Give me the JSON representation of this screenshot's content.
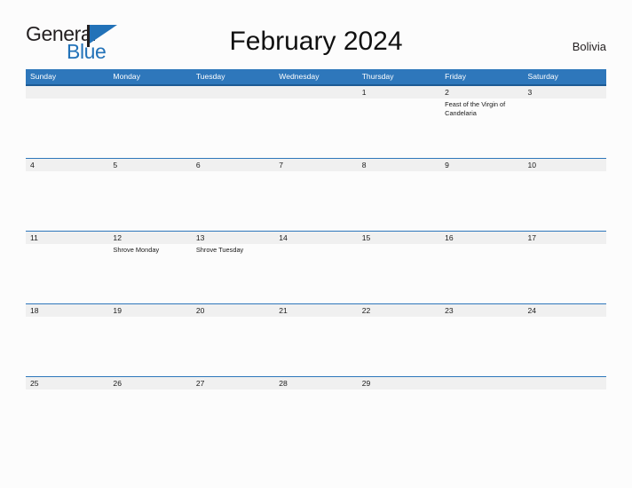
{
  "brand": {
    "name_part1": "General",
    "name_part2": "Blue",
    "flag_icon": "flag-triangle-icon"
  },
  "header": {
    "title": "February 2024",
    "region": "Bolivia"
  },
  "colors": {
    "header_blue": "#2e77bb",
    "header_rule": "#1c5a94",
    "row_rule": "#2e77bb",
    "date_band": "#f0f0f0",
    "brand_blue": "#2272b8",
    "page_bg": "#fcfcfc",
    "text": "#1a1a1a"
  },
  "calendar": {
    "month": "February",
    "year": "2024",
    "weekdays": [
      "Sunday",
      "Monday",
      "Tuesday",
      "Wednesday",
      "Thursday",
      "Friday",
      "Saturday"
    ],
    "weeks": [
      [
        {
          "date": "",
          "events": []
        },
        {
          "date": "",
          "events": []
        },
        {
          "date": "",
          "events": []
        },
        {
          "date": "",
          "events": []
        },
        {
          "date": "1",
          "events": []
        },
        {
          "date": "2",
          "events": [
            "Feast of the Virgin of Candelaria"
          ]
        },
        {
          "date": "3",
          "events": []
        }
      ],
      [
        {
          "date": "4",
          "events": []
        },
        {
          "date": "5",
          "events": []
        },
        {
          "date": "6",
          "events": []
        },
        {
          "date": "7",
          "events": []
        },
        {
          "date": "8",
          "events": []
        },
        {
          "date": "9",
          "events": []
        },
        {
          "date": "10",
          "events": []
        }
      ],
      [
        {
          "date": "11",
          "events": []
        },
        {
          "date": "12",
          "events": [
            "Shrove Monday"
          ]
        },
        {
          "date": "13",
          "events": [
            "Shrove Tuesday"
          ]
        },
        {
          "date": "14",
          "events": []
        },
        {
          "date": "15",
          "events": []
        },
        {
          "date": "16",
          "events": []
        },
        {
          "date": "17",
          "events": []
        }
      ],
      [
        {
          "date": "18",
          "events": []
        },
        {
          "date": "19",
          "events": []
        },
        {
          "date": "20",
          "events": []
        },
        {
          "date": "21",
          "events": []
        },
        {
          "date": "22",
          "events": []
        },
        {
          "date": "23",
          "events": []
        },
        {
          "date": "24",
          "events": []
        }
      ],
      [
        {
          "date": "25",
          "events": []
        },
        {
          "date": "26",
          "events": []
        },
        {
          "date": "27",
          "events": []
        },
        {
          "date": "28",
          "events": []
        },
        {
          "date": "29",
          "events": []
        },
        {
          "date": "",
          "events": []
        },
        {
          "date": "",
          "events": []
        }
      ]
    ]
  }
}
